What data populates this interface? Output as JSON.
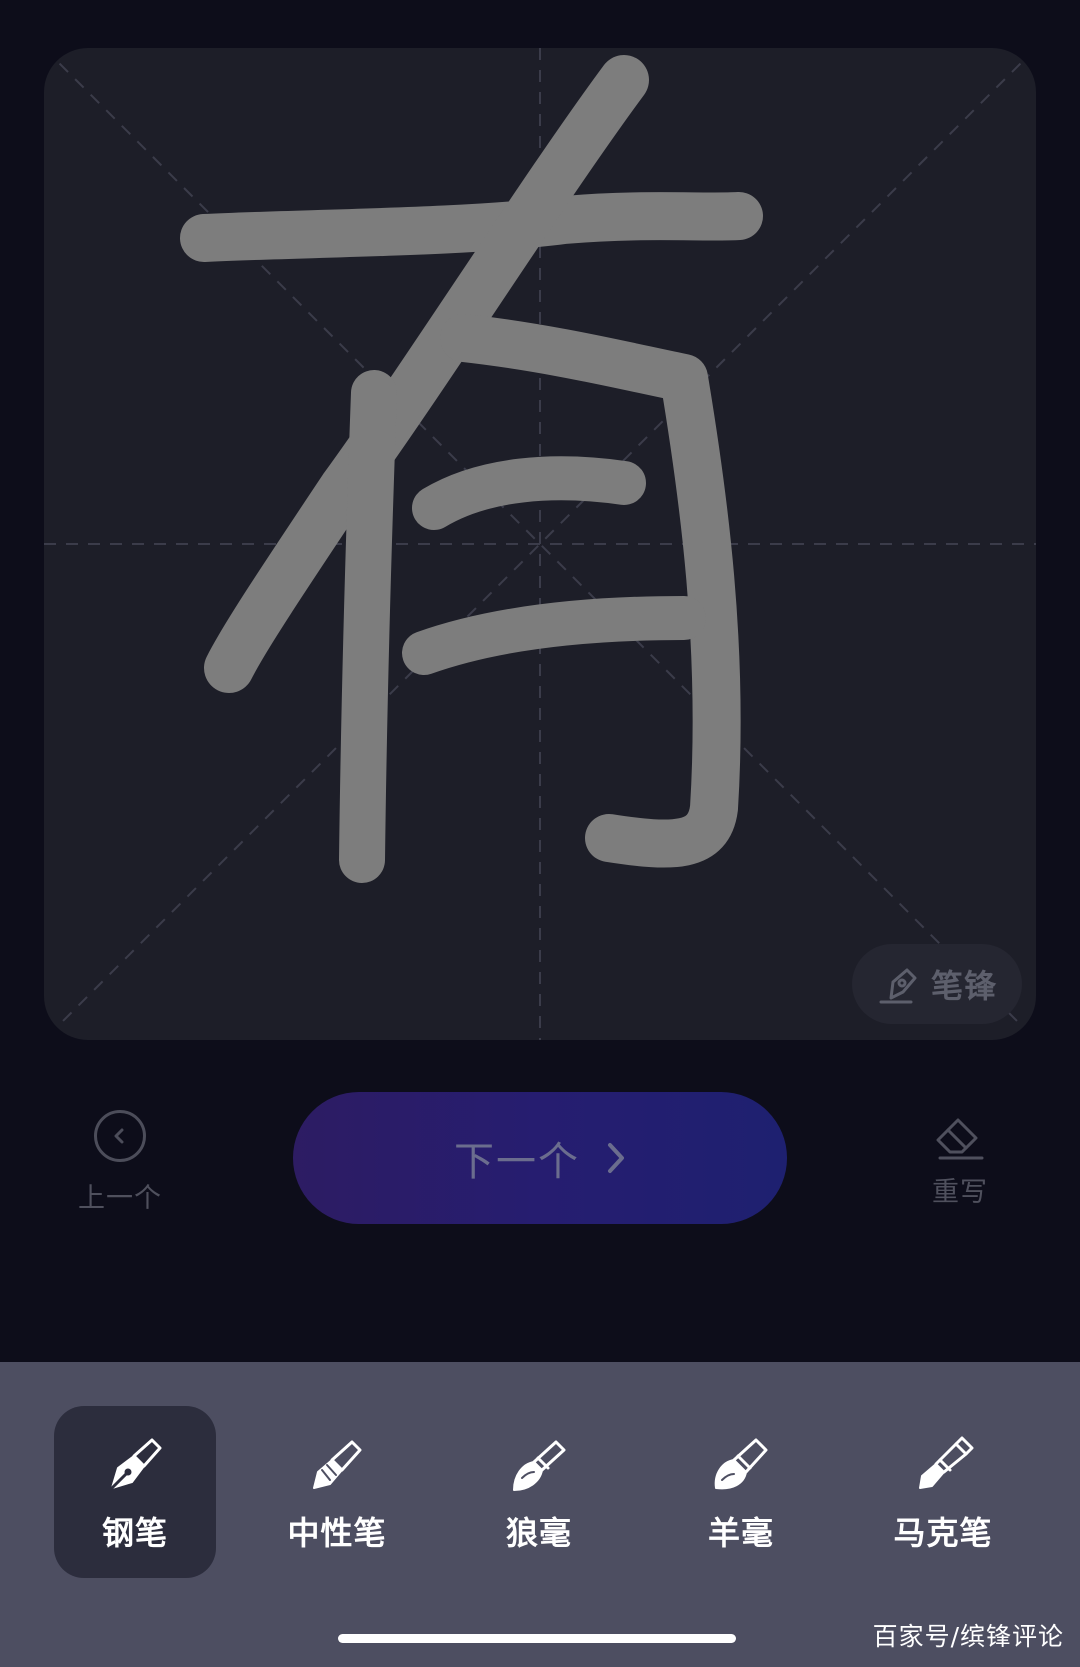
{
  "practice": {
    "character": "有",
    "brush_tip_label": "笔锋"
  },
  "controls": {
    "prev_label": "上一个",
    "next_label": "下一个",
    "rewrite_label": "重写"
  },
  "toolbar": {
    "tools": [
      {
        "label": "钢笔",
        "icon": "fountain-pen-icon",
        "active": true
      },
      {
        "label": "中性笔",
        "icon": "gel-pen-icon",
        "active": false
      },
      {
        "label": "狼毫",
        "icon": "wolf-hair-brush-icon",
        "active": false
      },
      {
        "label": "羊毫",
        "icon": "goat-hair-brush-icon",
        "active": false
      },
      {
        "label": "马克笔",
        "icon": "marker-pen-icon",
        "active": false
      }
    ]
  },
  "watermark": "百家号/缤锋评论",
  "colors": {
    "background": "#0d0d1a",
    "canvas": "#1d1e28",
    "stroke": "#7d7d7d",
    "next_button_start": "#2d1c63",
    "next_button_end": "#1e2070",
    "toolbar": "#4d4e61",
    "toolbar_active": "#2c2d3d"
  }
}
